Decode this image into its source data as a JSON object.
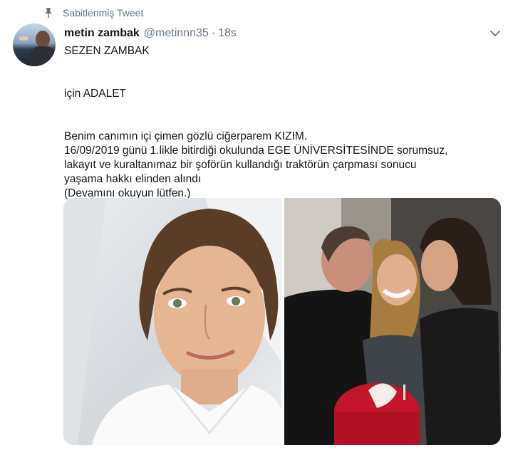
{
  "pinned": {
    "label": "Sabitlenmiş Tweet"
  },
  "tweet": {
    "author_name": "metin zambak",
    "handle": "@metinnn35",
    "separator": "·",
    "time": "18s",
    "lines": [
      "SEZEN ZAMBAK",
      "",
      "için ADALET",
      "",
      "Benim canımın içi çimen gözlü ciğerparem KIZIM.",
      "16/09/2019 günü 1.likle bitirdiği okulunda EGE ÜNİVERSİTESİNDE sorumsuz,",
      "lakayıt ve kuraltanımaz bir şoförün kullandığı traktörün çarpması sonucu",
      "yaşama hakkı elinden alındı",
      "(Devamını okuyun lütfen.)"
    ]
  },
  "icons": {
    "pin": "pin-icon",
    "more": "chevron-down-icon"
  },
  "colors": {
    "secondary_text": "#657786",
    "primary_text": "#14171a"
  }
}
